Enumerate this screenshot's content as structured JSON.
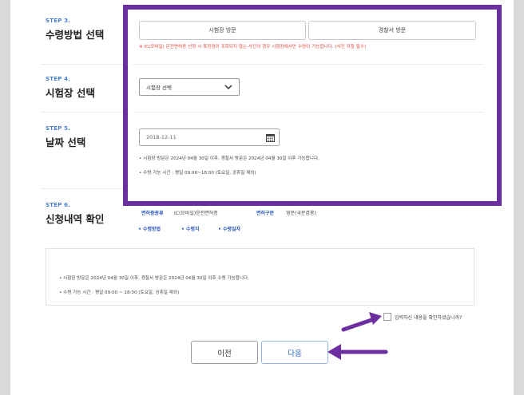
{
  "step3": {
    "num": "STEP 3.",
    "title": "수령방법 선택",
    "options": [
      "시험장 방문",
      "경찰서 방문"
    ],
    "warning": "※ IC(모바일) 운전면허증 신청 시 특징점이 조회되지 않는 사진의 경우 시험장에서만 수령이 가능합니다. (사진 지참 필수)"
  },
  "step4": {
    "num": "STEP 4.",
    "title": "시험장 선택",
    "select_value": "시험장 선택"
  },
  "step5": {
    "num": "STEP 5.",
    "title": "날짜 선택",
    "date_value": "2018-12-11",
    "bullets": [
      "시험장 방문은 2024년 04월 30일 이후, 경찰서 방문은 2024년 04월 30일 이후 가능합니다.",
      "수령 가능 시간 : 평일 09:00~18:00 (토요일, 공휴일 제외)"
    ]
  },
  "step6": {
    "num": "STEP 6.",
    "title": "신청내역 확인",
    "row1": [
      {
        "label": "면허증종류",
        "value": "IC(모바일)운전면허증"
      },
      {
        "label": "면허구분",
        "value": "영문(국문겸용)"
      }
    ],
    "row2": [
      "수령방법",
      "수령지",
      "수령일자"
    ]
  },
  "notes": [
    "시험장 방문은 2024년 04월 30일 이후, 경찰서 방문은 2024년 04월 30일 이후 수령 가능합니다.",
    "수령 가능 시간 : 평일 09:00 ~ 18:00 (토요일, 공휴일 제외)"
  ],
  "confirm_label": "입력하신 내용을 확인하셨습니까?",
  "buttons": {
    "prev": "이전",
    "next": "다음"
  },
  "colors": {
    "highlight": "#6d2fa0",
    "step_blue": "#4a7fd0",
    "warning_red": "#e04b3c"
  }
}
